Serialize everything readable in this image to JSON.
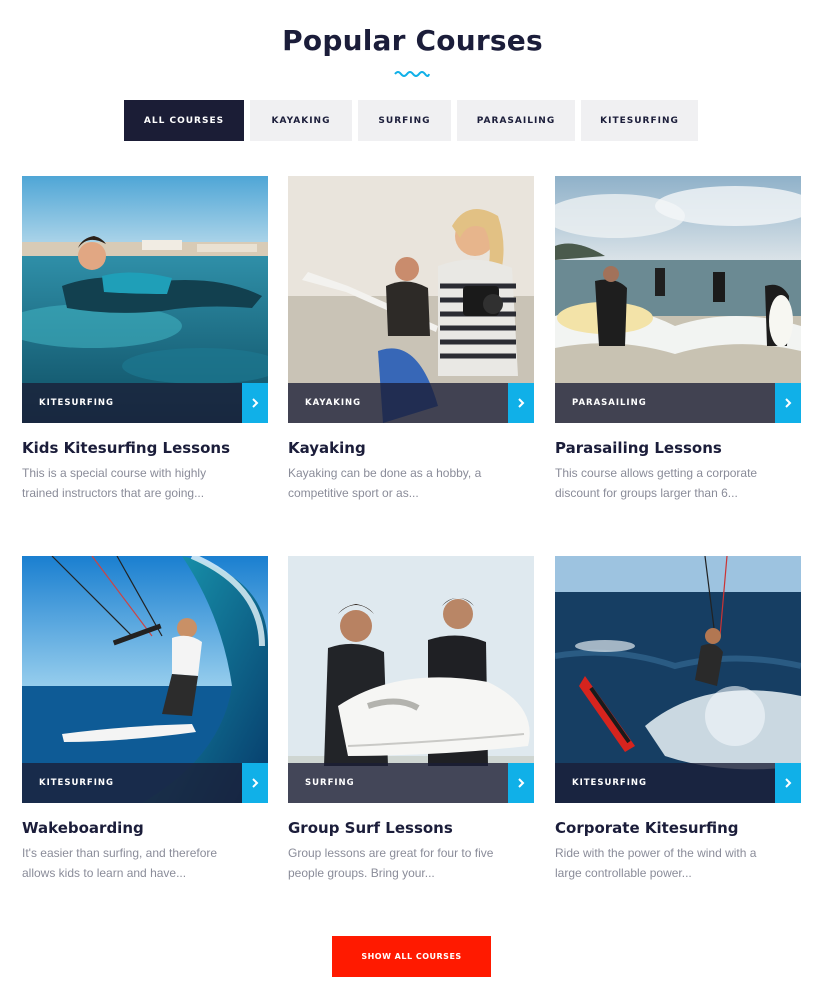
{
  "section": {
    "title": "Popular Courses"
  },
  "filters": [
    "ALL COURSES",
    "KAYAKING",
    "SURFING",
    "PARASAILING",
    "KITESURFING"
  ],
  "active_filter": "ALL COURSES",
  "courses": [
    {
      "category": "KITESURFING",
      "title": "Kids Kitesurfing Lessons",
      "desc_line1": "This is a special course with highly",
      "desc_line2": "trained instructors that are going..."
    },
    {
      "category": "KAYAKING",
      "title": "Kayaking",
      "desc_line1": "Kayaking can be done as a hobby, a",
      "desc_line2": "competitive sport or as..."
    },
    {
      "category": "PARASAILING",
      "title": "Parasailing Lessons",
      "desc_line1": "This course allows getting a corporate",
      "desc_line2": "discount for groups larger than 6..."
    },
    {
      "category": "KITESURFING",
      "title": "Wakeboarding",
      "desc_line1": "It's easier than surfing, and therefore",
      "desc_line2": "allows kids to learn and have..."
    },
    {
      "category": "SURFING",
      "title": "Group Surf Lessons",
      "desc_line1": "Group lessons are great for four to five",
      "desc_line2": "people groups. Bring your..."
    },
    {
      "category": "KITESURFING",
      "title": "Corporate Kitesurfing",
      "desc_line1": "Ride with the power of the wind with a",
      "desc_line2": "large controllable power..."
    }
  ],
  "show_all_button": "SHOW ALL COURSES",
  "colors": {
    "navy": "#1b1d36",
    "accent_blue": "#10b0e8",
    "cta_red": "#ff1a00",
    "filter_bg": "#f0f0f2",
    "muted_text": "#8a8c99"
  }
}
